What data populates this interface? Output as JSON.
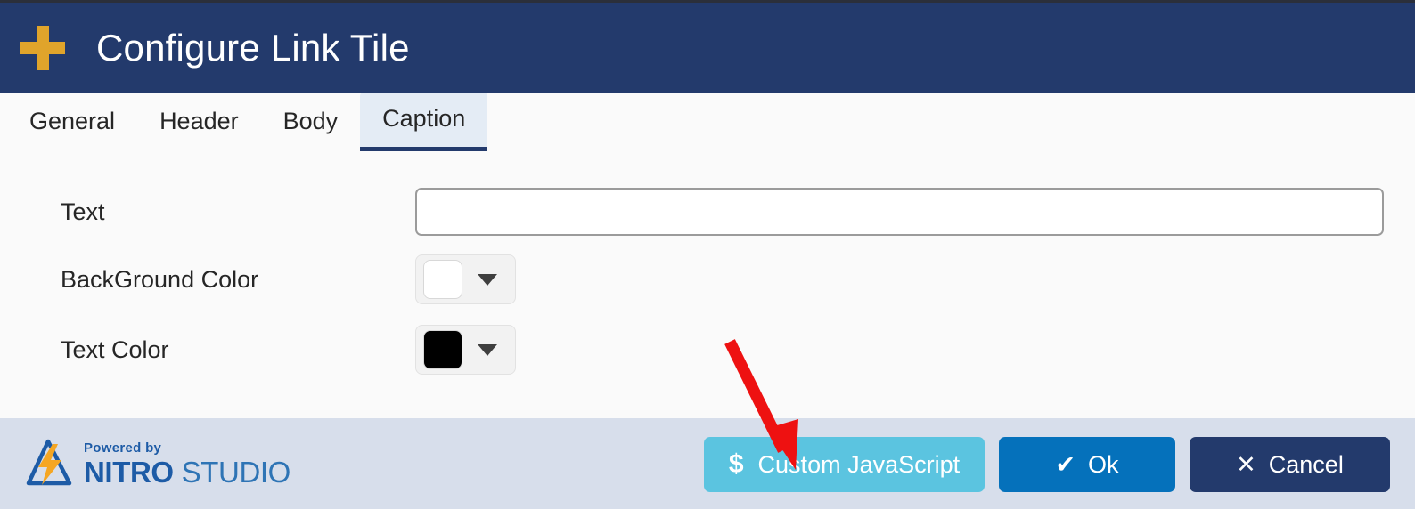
{
  "window": {
    "title": "Configure Link Tile",
    "add_icon": "plus-icon"
  },
  "tabs": [
    {
      "label": "General",
      "active": false
    },
    {
      "label": "Header",
      "active": false
    },
    {
      "label": "Body",
      "active": false
    },
    {
      "label": "Caption",
      "active": true
    }
  ],
  "form": {
    "rows": [
      {
        "label": "Text",
        "type": "text",
        "value": "",
        "placeholder": ""
      },
      {
        "label": "BackGround Color",
        "type": "color",
        "swatch": "#ffffff"
      },
      {
        "label": "Text Color",
        "type": "color",
        "swatch": "#000000"
      }
    ]
  },
  "footer": {
    "brand": {
      "powered_by": "Powered by",
      "nitro": "NITRO",
      "studio": "STUDIO",
      "mark_icon": "nitro-lightning-triangle-icon"
    },
    "buttons": [
      {
        "label": "Custom JavaScript",
        "glyph": "$",
        "icon": "dollar-icon",
        "color": "#5bc4e0"
      },
      {
        "label": "Ok",
        "glyph": "✔",
        "icon": "check-icon",
        "color": "#0571bb"
      },
      {
        "label": "Cancel",
        "glyph": "✕",
        "icon": "close-x-icon",
        "color": "#233a6c"
      }
    ]
  },
  "annotation": {
    "type": "arrow",
    "color": "#ee1111",
    "points_to": "Custom JavaScript"
  },
  "colors": {
    "header_navy": "#233a6c",
    "accent_gold": "#e0a42b",
    "tab_active_bg": "#e4ecf5",
    "content_bg": "#fafafa",
    "footer_bg": "#d7deeb"
  }
}
